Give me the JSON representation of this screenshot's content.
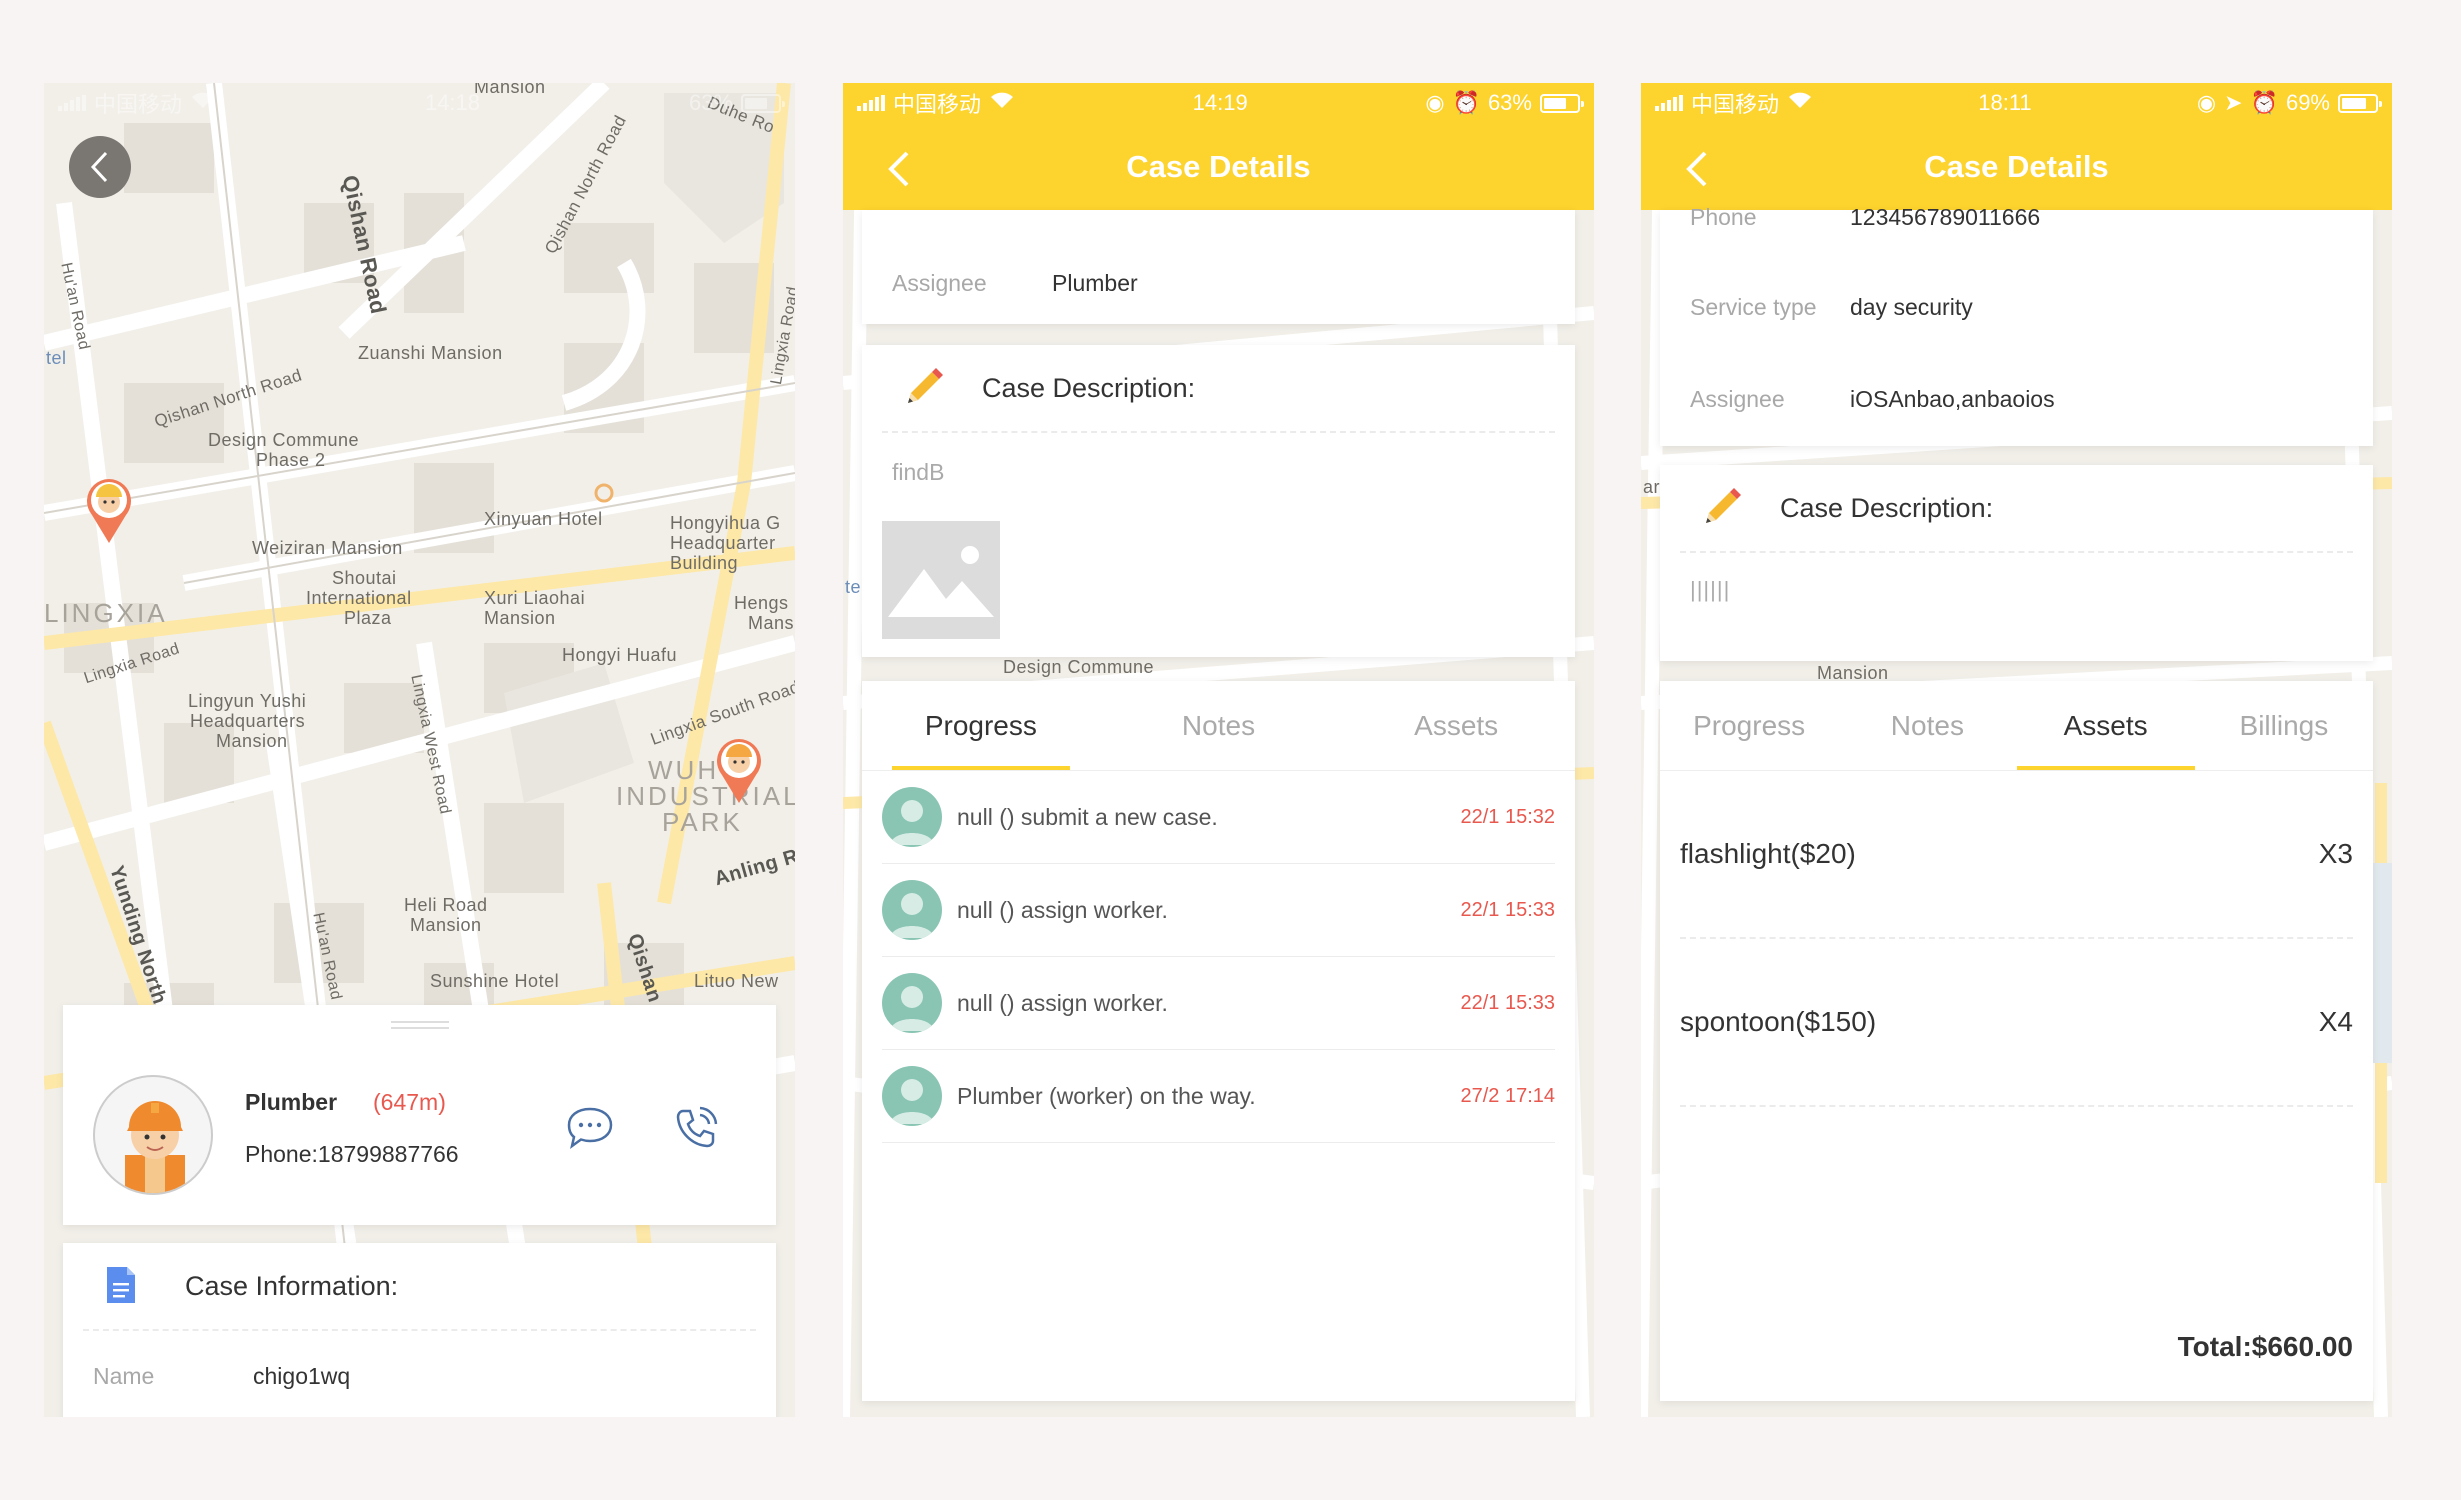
{
  "screen1": {
    "status": {
      "carrier": "中国移动",
      "time": "14:18",
      "battery": "63%"
    },
    "map_labels": {
      "mansion_top": "Mansion",
      "qishan_road": "Qishan Road",
      "qishan_north_road": "Qishan North Road",
      "duhe_road": "Duhe Ro",
      "hu_an_road": "Hu'an Road",
      "tel": "tel",
      "zuanshi": "Zuanshi Mansion",
      "qishan_north_road2": "Qishan North Road",
      "design_commune": "Design Commune",
      "phase2": "Phase 2",
      "lingxia_road": "Lingxia Road",
      "xinyuan": "Xinyuan Hotel",
      "hongyihua": "Hongyihua G",
      "headquarter": "Headquarter",
      "building": "Building",
      "weiziran": "Weiziran Mansion",
      "shoutai": "Shoutai",
      "international": "International",
      "plaza": "Plaza",
      "xuri": "Xuri Liaohai",
      "xuri2": "Mansion",
      "lingxia_big": "LINGXIA",
      "lingxia_road2": "Lingxia Road",
      "hengs": "Hengs",
      "mans": "Mans",
      "hongyi_huafu": "Hongyi Huafu",
      "lingyun": "Lingyun Yushi",
      "headquarters": "Headquarters",
      "mansion3": "Mansion",
      "lingxia_west": "Lingxia West Road",
      "lingxia_south": "Lingxia South Road",
      "wuh": "WUH",
      "industrial": "INDUSTRIAL",
      "park": "PARK",
      "anling": "Anling R",
      "yunding": "Yunding North",
      "heli": "Heli Road",
      "heli2": "Mansion",
      "hu_an_road2": "Hu'an Road",
      "qishan2": "Qishan",
      "sunshine": "Sunshine Hotel",
      "lituo": "Lituo New"
    },
    "worker": {
      "name": "Plumber",
      "distance": "(647m)",
      "phone": "Phone:18799887766"
    },
    "case_info_title": "Case Information:",
    "name_label": "Name",
    "name_value": "chigo1wq"
  },
  "screen2": {
    "status": {
      "carrier": "中国移动",
      "time": "14:19",
      "battery": "63%"
    },
    "title": "Case Details",
    "assignee_label": "Assignee",
    "assignee_value": "Plumber",
    "desc_title": "Case Description:",
    "desc_text": "findB",
    "map_label": "Design Commune",
    "tabs": [
      "Progress",
      "Notes",
      "Assets"
    ],
    "progress": [
      {
        "text": "null () submit a new case.",
        "time": "22/1 15:32"
      },
      {
        "text": "null () assign worker.",
        "time": "22/1 15:33"
      },
      {
        "text": "null () assign worker.",
        "time": "22/1 15:33"
      },
      {
        "text": "Plumber (worker) on the way.",
        "time": "27/2 17:14"
      }
    ]
  },
  "screen3": {
    "status": {
      "carrier": "中国移动",
      "time": "18:11",
      "battery": "69%"
    },
    "title": "Case Details",
    "phone_label": "Phone",
    "phone_value": "123456789011666",
    "service_label": "Service type",
    "service_value": "day security",
    "assignee_label": "Assignee",
    "assignee_value": "iOSAnbao,anbaoios",
    "desc_title": "Case Description:",
    "desc_text": "||||||",
    "map_label": "Mansion",
    "tabs": [
      "Progress",
      "Notes",
      "Assets",
      "Billings"
    ],
    "assets": [
      {
        "name": "flashlight($20)",
        "qty": "X3"
      },
      {
        "name": "spontoon($150)",
        "qty": "X4"
      }
    ],
    "total": "Total:$660.00"
  },
  "colors": {
    "accent": "#fdd32e",
    "time_red": "#e8584e",
    "avatar_green": "#8ac5b4"
  }
}
